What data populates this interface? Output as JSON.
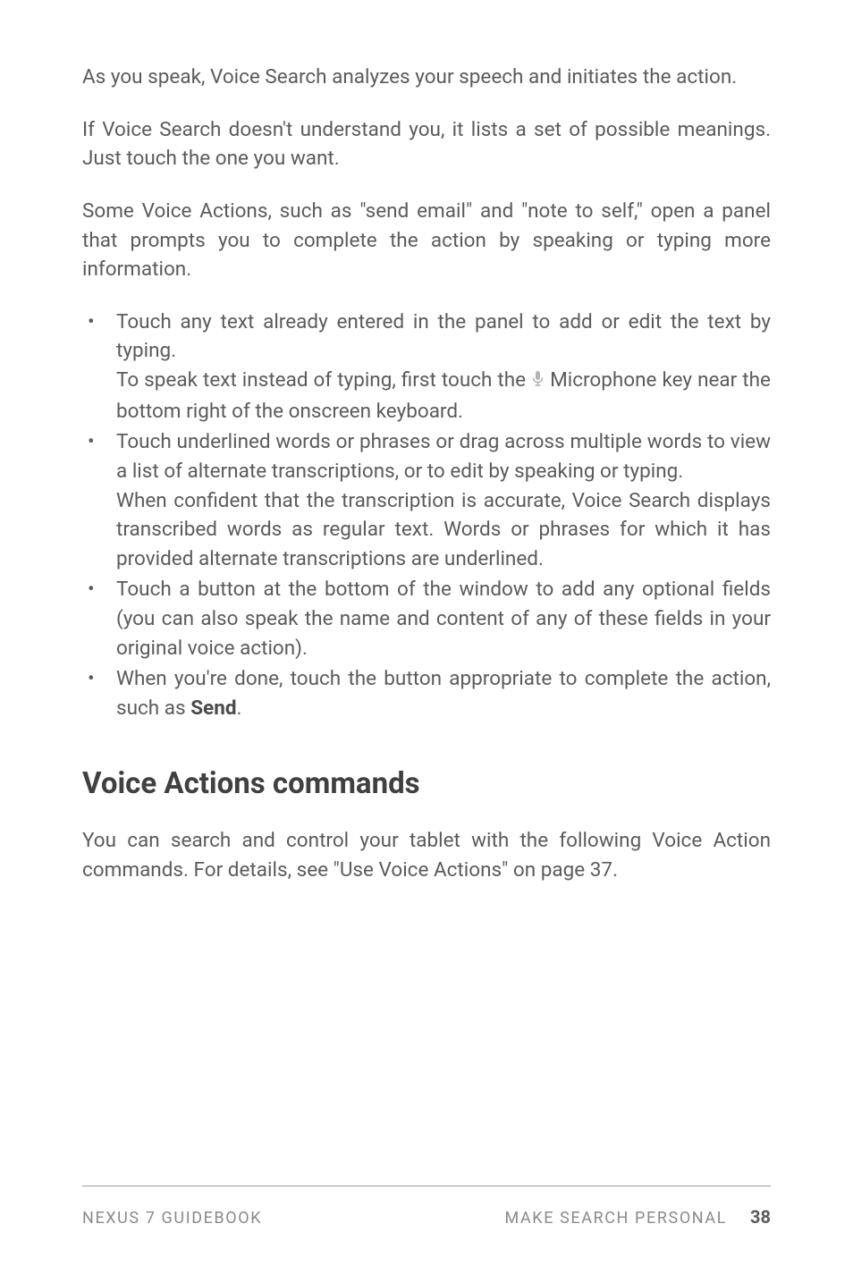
{
  "paragraphs": {
    "p1": "As you speak, Voice Search analyzes your speech and initiates the action.",
    "p2": "If Voice Search doesn't understand you, it lists a set of possible meanings. Just touch the one you want.",
    "p3": "Some Voice Actions, such as \"send email\" and \"note to self,\" open a panel that prompts you to complete the action by speaking or typing more information."
  },
  "bullets": {
    "b1a": "Touch any text already entered in the panel to add or edit the text by typing.",
    "b1b_pre": "To speak text instead of typing, first touch the ",
    "b1b_post": " Microphone key near the bottom right of the onscreen keyboard.",
    "b2a": "Touch underlined words or phrases or drag across multiple words to view a list of alternate transcriptions, or to edit by speaking or typing.",
    "b2b": "When confident that the transcription is accurate, Voice Search displays transcribed words as regular text. Words or phrases for which it has provided alternate transcriptions are underlined.",
    "b3": "Touch a button at the bottom of the window to add any optional fields (you can also speak the name and content of any of these fields in your original voice action).",
    "b4_pre": "When you're done, touch the button appropriate to complete the action, such as ",
    "b4_bold": "Send",
    "b4_post": "."
  },
  "heading": "Voice Actions commands",
  "section_para": "You can search and control your tablet with the following Voice Action commands. For details, see \"Use Voice Actions\" on page 37.",
  "footer": {
    "left": "NEXUS 7 GUIDEBOOK",
    "right": "MAKE SEARCH PERSONAL",
    "page": "38"
  }
}
